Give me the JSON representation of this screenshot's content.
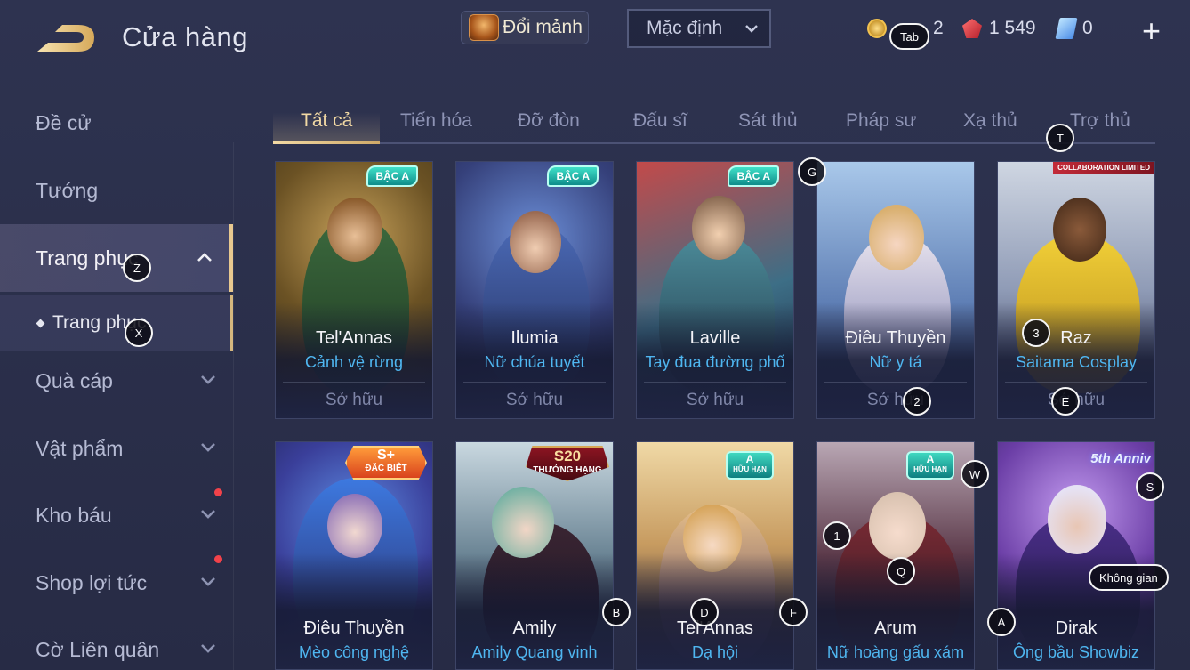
{
  "header": {
    "title": "Cửa hàng",
    "exchange_label": "Đổi mảnh",
    "sort_value": "Mặc định"
  },
  "currencies": {
    "gold_value": "2",
    "ruby_value": "1 549",
    "voucher_value": "0"
  },
  "sidebar": {
    "items": [
      {
        "label": "Đề cử"
      },
      {
        "label": "Tướng"
      },
      {
        "label": "Trang phục"
      },
      {
        "label": "Quà cáp"
      },
      {
        "label": "Vật phẩm"
      },
      {
        "label": "Kho báu"
      },
      {
        "label": "Shop lợi tức"
      },
      {
        "label": "Cờ Liên quân"
      }
    ],
    "sub_item": "Trang phục"
  },
  "tabs": [
    "Tất cả",
    "Tiến hóa",
    "Đỡ đòn",
    "Đấu sĩ",
    "Sát thủ",
    "Pháp sư",
    "Xạ thủ",
    "Trợ thủ"
  ],
  "cards": [
    {
      "hero": "Tel'Annas",
      "skin": "Cảnh vệ rừng",
      "status": "Sở hữu",
      "badge": "BẬC A"
    },
    {
      "hero": "Ilumia",
      "skin": "Nữ chúa tuyết",
      "status": "Sở hữu",
      "badge": "BẬC A"
    },
    {
      "hero": "Laville",
      "skin": "Tay đua đường phố",
      "status": "Sở hữu",
      "badge": "BẬC A"
    },
    {
      "hero": "Điêu Thuyền",
      "skin": "Nữ y tá",
      "status": "Sở hữu",
      "badge": ""
    },
    {
      "hero": "Raz",
      "skin": "Saitama Cosplay",
      "status": "Sở hữu",
      "badge": "COLLABORATION LIMITED"
    },
    {
      "hero": "Điêu Thuyền",
      "skin": "Mèo công nghệ",
      "badge_a": "S+",
      "badge_b": "ĐẶC BIỆT"
    },
    {
      "hero": "Amily",
      "skin": "Amily Quang vinh",
      "badge_a": "S20",
      "badge_b": "THƯỞNG HẠNG"
    },
    {
      "hero": "Tel'Annas",
      "skin": "Dạ hội",
      "badge_a": "A",
      "badge_b": "HỮU HẠN"
    },
    {
      "hero": "Arum",
      "skin": "Nữ hoàng gấu xám",
      "badge_a": "A",
      "badge_b": "HỮU HẠN"
    },
    {
      "hero": "Dirak",
      "skin": "Ông bầu Showbiz",
      "badge_a": "5th Anniv"
    }
  ],
  "key_hints": {
    "tab": "Tab",
    "t": "T",
    "g": "G",
    "z": "Z",
    "x": "X",
    "three": "3",
    "two": "2",
    "e": "E",
    "w": "W",
    "s": "S",
    "one": "1",
    "q": "Q",
    "space": "Không gian",
    "b": "B",
    "d": "D",
    "f": "F",
    "a": "A"
  },
  "colors": {
    "accent_gold": "#f2d9a4",
    "skin_name_blue": "#4fb6f0",
    "notification_red": "#f2424a"
  }
}
